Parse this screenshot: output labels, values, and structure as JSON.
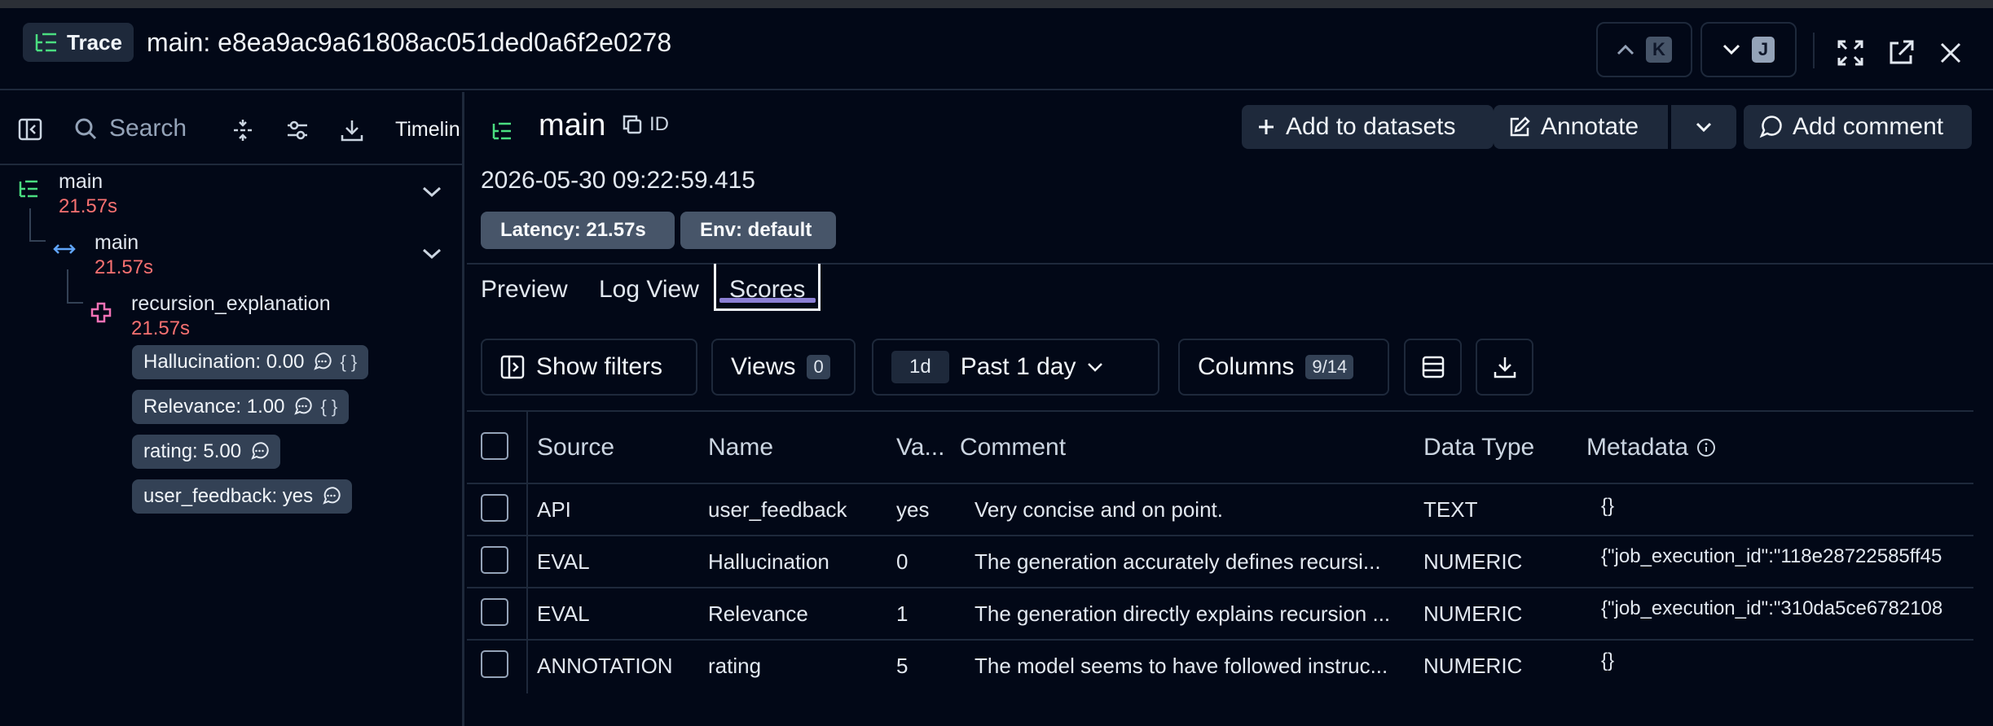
{
  "header": {
    "badge_label": "Trace",
    "title": "main: e8ea9ac9a61808ac051ded0a6f2e0278",
    "prev_key": "K",
    "next_key": "J"
  },
  "sidebar": {
    "search_placeholder": "Search",
    "timeline_label": "Timelin",
    "tree": [
      {
        "name": "main",
        "latency": "21.57s",
        "icon": "trace-icon"
      },
      {
        "name": "main",
        "latency": "21.57s",
        "icon": "span-arrows-icon"
      },
      {
        "name": "recursion_explanation",
        "latency": "21.57s",
        "icon": "generation-icon"
      }
    ],
    "score_chips": [
      {
        "label": "Hallucination: 0.00",
        "has_braces": true
      },
      {
        "label": "Relevance: 1.00",
        "has_braces": true
      },
      {
        "label": "rating: 5.00",
        "has_braces": false
      },
      {
        "label": "user_feedback: yes",
        "has_braces": false
      }
    ],
    "braces": "{ }"
  },
  "main": {
    "title": "main",
    "id_label": "ID",
    "add_to_datasets_label": "Add to datasets",
    "annotate_label": "Annotate",
    "add_comment_label": "Add comment",
    "timestamp": "2026-05-30 09:22:59.415",
    "badges": {
      "latency": "Latency: 21.57s",
      "env": "Env: default"
    },
    "tabs": [
      {
        "label": "Preview",
        "active": false
      },
      {
        "label": "Log View",
        "active": false
      },
      {
        "label": "Scores",
        "active": true
      }
    ],
    "toolbar": {
      "show_filters": "Show filters",
      "views_label": "Views",
      "views_count": "0",
      "range_short": "1d",
      "range_label": "Past 1 day",
      "columns_label": "Columns",
      "columns_count": "9/14"
    },
    "table": {
      "headers": [
        "Source",
        "Name",
        "Va...",
        "Comment",
        "Data Type",
        "Metadata"
      ],
      "rows": [
        {
          "source": "API",
          "name": "user_feedback",
          "value": "yes",
          "comment": "Very concise and on point.",
          "data_type": "TEXT",
          "metadata": "{}"
        },
        {
          "source": "EVAL",
          "name": "Hallucination",
          "value": "0",
          "comment": "The generation accurately defines recursi...",
          "data_type": "NUMERIC",
          "metadata": "{\"job_execution_id\":\"118e28722585ff45"
        },
        {
          "source": "EVAL",
          "name": "Relevance",
          "value": "1",
          "comment": "The generation directly explains recursion ...",
          "data_type": "NUMERIC",
          "metadata": "{\"job_execution_id\":\"310da5ce6782108"
        },
        {
          "source": "ANNOTATION",
          "name": "rating",
          "value": "5",
          "comment": "The model seems to have followed instruc...",
          "data_type": "NUMERIC",
          "metadata": "{}"
        }
      ]
    }
  },
  "colors": {
    "background": "#020817",
    "border": "#1e293b",
    "latency": "#f87171",
    "trace_icon": "#4ade80",
    "generation_icon": "#f472b6",
    "span_icon": "#60a5fa",
    "tab_accent": "#8b7fd4"
  }
}
